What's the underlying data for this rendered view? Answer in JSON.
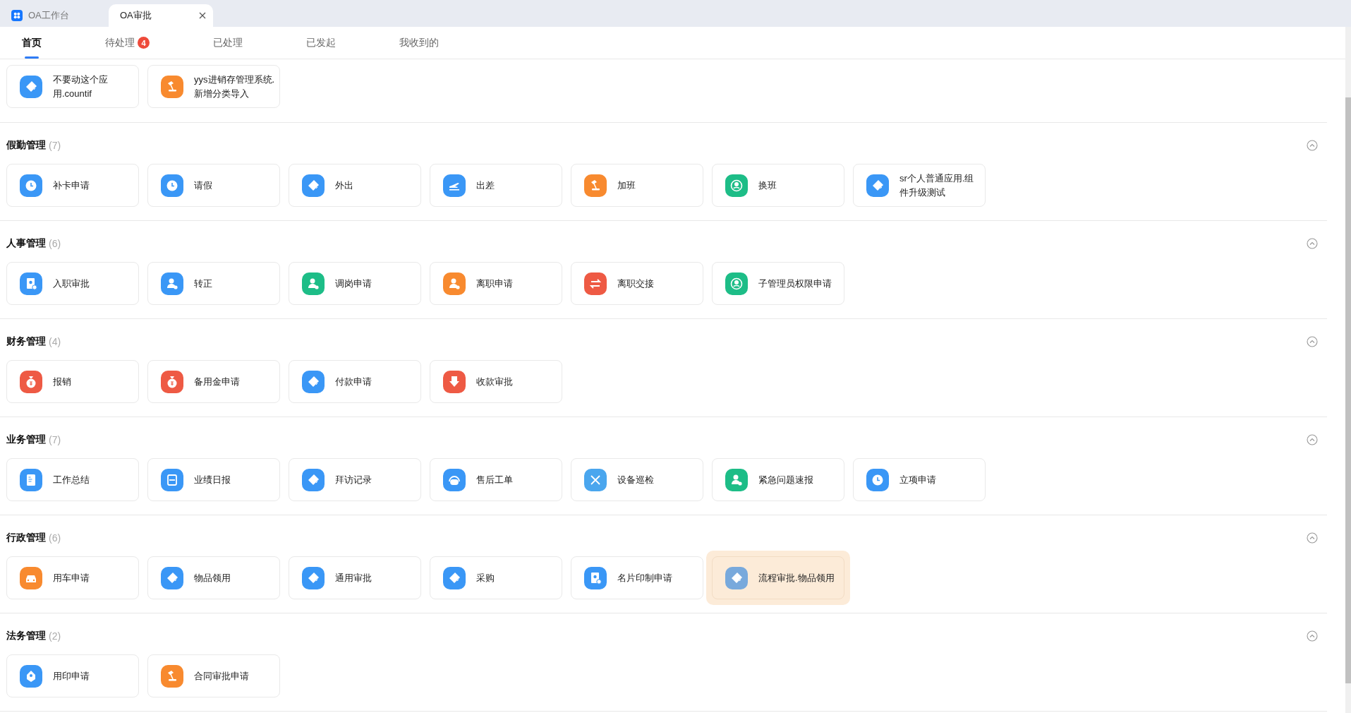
{
  "browser_tabs": [
    {
      "label": "OA工作台",
      "selected": false,
      "icon": true,
      "closable": false
    },
    {
      "label": "OA审批",
      "selected": true,
      "icon": false,
      "closable": true
    }
  ],
  "nav_tabs": [
    {
      "label": "首页",
      "selected": true
    },
    {
      "label": "待处理",
      "selected": false,
      "badge": "4"
    },
    {
      "label": "已处理",
      "selected": false
    },
    {
      "label": "已发起",
      "selected": false
    },
    {
      "label": "我收到的",
      "selected": false
    }
  ],
  "sections": [
    {
      "items": [
        {
          "label": "不要动这个应用.countif",
          "kind": "tag",
          "color": "#3a97f6",
          "hovered": false
        },
        {
          "label": "yys进销存管理系统.新增分类导入",
          "kind": "lamp",
          "color": "#f88a2f",
          "hovered": false
        }
      ]
    },
    {
      "title": "假勤管理",
      "count": "(7)",
      "expanded": true,
      "items": [
        {
          "label": "补卡申请",
          "kind": "clock",
          "color": "#3a97f6",
          "hovered": false
        },
        {
          "label": "请假",
          "kind": "clock",
          "color": "#3a97f6",
          "hovered": false
        },
        {
          "label": "外出",
          "kind": "tag",
          "color": "#3a97f6",
          "hovered": false
        },
        {
          "label": "出差",
          "kind": "plane",
          "color": "#3a97f6",
          "hovered": false
        },
        {
          "label": "加班",
          "kind": "lamp",
          "color": "#f88a2f",
          "hovered": false
        },
        {
          "label": "换班",
          "kind": "swap",
          "color": "#1dbd87",
          "hovered": false
        },
        {
          "label": "sr个人普通应用.组件升级测试",
          "kind": "tag",
          "color": "#3a97f6",
          "hovered": false
        }
      ]
    },
    {
      "title": "人事管理",
      "count": "(6)",
      "expanded": true,
      "items": [
        {
          "label": "入职审批",
          "kind": "card",
          "color": "#3a97f6",
          "hovered": false
        },
        {
          "label": "转正",
          "kind": "person",
          "color": "#3a97f6",
          "hovered": false
        },
        {
          "label": "调岗申请",
          "kind": "person",
          "color": "#1dbd87",
          "hovered": false
        },
        {
          "label": "离职申请",
          "kind": "person",
          "color": "#f88a2f",
          "hovered": false
        },
        {
          "label": "离职交接",
          "kind": "exchange",
          "color": "#ee5a44",
          "hovered": false
        },
        {
          "label": "子管理员权限申请",
          "kind": "swap",
          "color": "#1dbd87",
          "hovered": false
        }
      ]
    },
    {
      "title": "财务管理",
      "count": "(4)",
      "expanded": true,
      "items": [
        {
          "label": "报销",
          "kind": "bag",
          "color": "#ee5a44",
          "hovered": false
        },
        {
          "label": "备用金申请",
          "kind": "bag",
          "color": "#ee5a44",
          "hovered": false
        },
        {
          "label": "付款申请",
          "kind": "tag",
          "color": "#3a97f6",
          "hovered": false
        },
        {
          "label": "收款审批",
          "kind": "down",
          "color": "#ee5a44",
          "hovered": false
        }
      ]
    },
    {
      "title": "业务管理",
      "count": "(7)",
      "expanded": true,
      "items": [
        {
          "label": "工作总结",
          "kind": "doc",
          "color": "#3a97f6",
          "hovered": false
        },
        {
          "label": "业绩日报",
          "kind": "calendar",
          "color": "#3a97f6",
          "hovered": false
        },
        {
          "label": "拜访记录",
          "kind": "tag",
          "color": "#3a97f6",
          "hovered": false
        },
        {
          "label": "售后工单",
          "kind": "headset",
          "color": "#3a97f6",
          "hovered": false
        },
        {
          "label": "设备巡检",
          "kind": "tools",
          "color": "#4aa6ee",
          "hovered": false
        },
        {
          "label": "紧急问题速报",
          "kind": "person",
          "color": "#1dbd87",
          "hovered": false
        },
        {
          "label": "立项申请",
          "kind": "clock",
          "color": "#3a97f6",
          "hovered": false
        }
      ]
    },
    {
      "title": "行政管理",
      "count": "(6)",
      "expanded": true,
      "items": [
        {
          "label": "用车申请",
          "kind": "car",
          "color": "#f88a2f",
          "hovered": false
        },
        {
          "label": "物品领用",
          "kind": "tag",
          "color": "#3a97f6",
          "hovered": false
        },
        {
          "label": "通用审批",
          "kind": "tag",
          "color": "#3a97f6",
          "hovered": false
        },
        {
          "label": "采购",
          "kind": "tag",
          "color": "#3a97f6",
          "hovered": false
        },
        {
          "label": "名片印制申请",
          "kind": "card",
          "color": "#3a97f6",
          "hovered": false
        },
        {
          "label": "流程审批.物品领用",
          "kind": "tag",
          "color": "#78a9dc",
          "hovered": true
        }
      ]
    },
    {
      "title": "法务管理",
      "count": "(2)",
      "expanded": true,
      "items": [
        {
          "label": "用印申请",
          "kind": "seal",
          "color": "#3a97f6",
          "hovered": false
        },
        {
          "label": "合同审批申请",
          "kind": "lamp",
          "color": "#f88a2f",
          "hovered": false
        }
      ]
    }
  ]
}
